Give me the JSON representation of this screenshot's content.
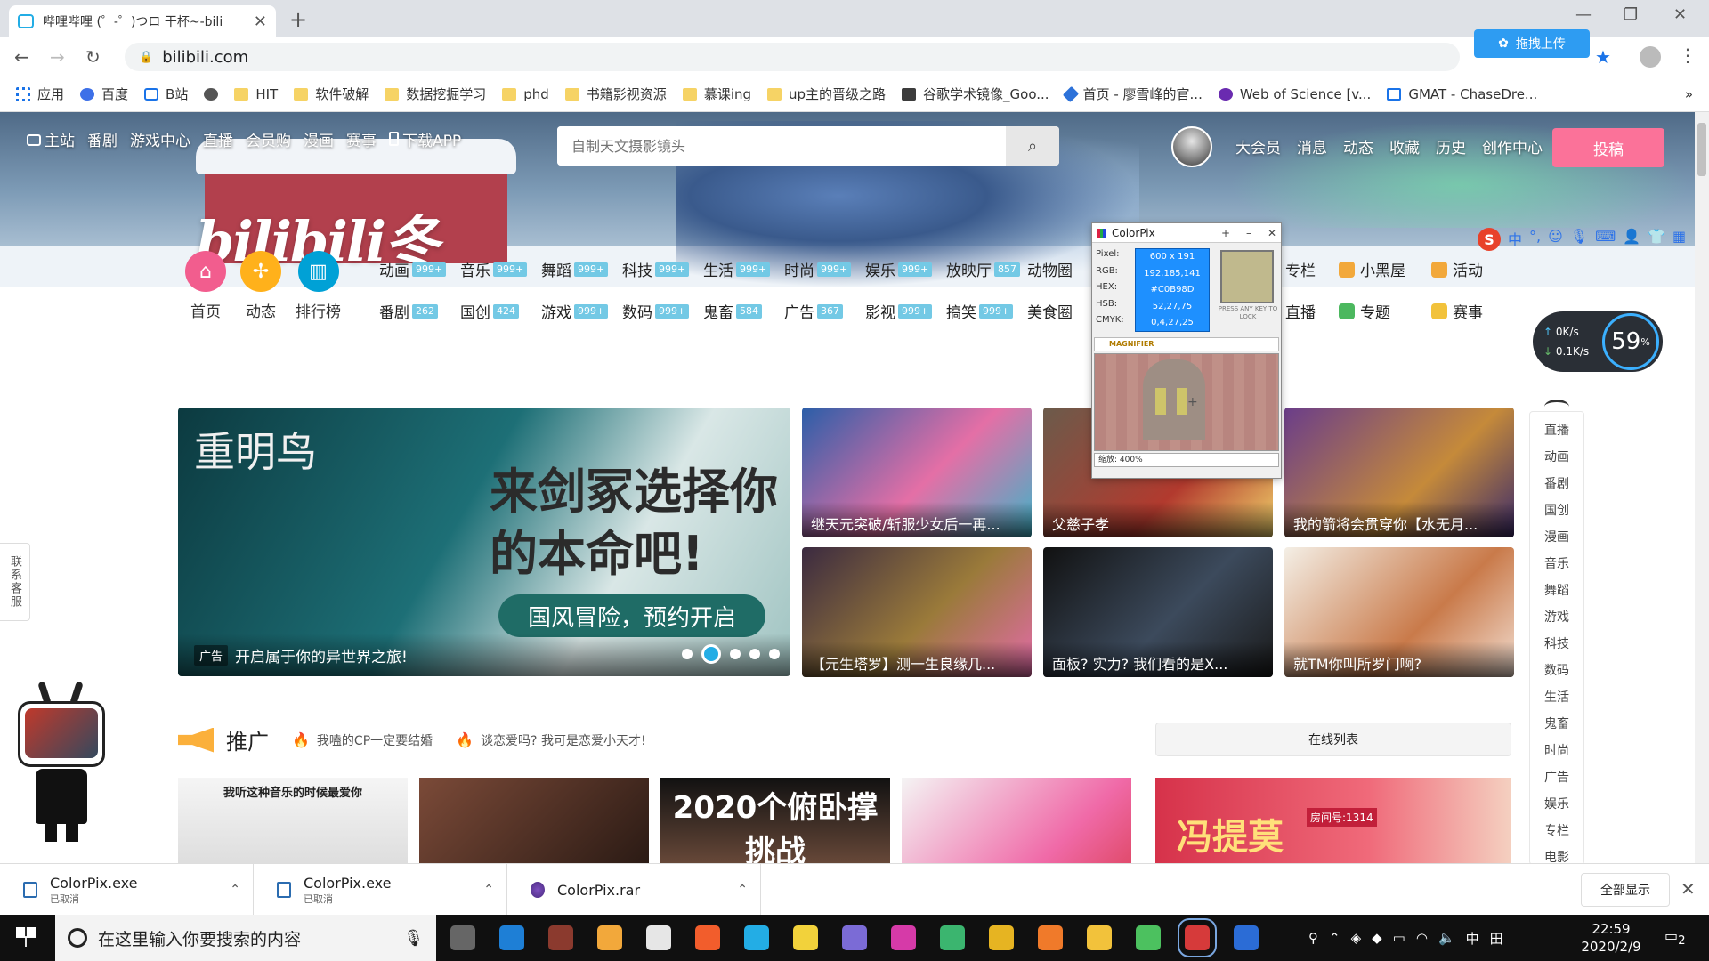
{
  "browser": {
    "tab_title": "哔哩哔哩 (゜-゜)つロ 干杯~-bili",
    "url": "bilibili.com",
    "upload_extension": "拖拽上传",
    "bookmarks": [
      {
        "label": "应用",
        "icon": "apps-grid-icon"
      },
      {
        "label": "百度",
        "icon": "baidu-paw-icon"
      },
      {
        "label": "B站",
        "icon": "bilibili-tv-icon"
      },
      {
        "label": "",
        "icon": "globe-icon"
      },
      {
        "label": "HIT",
        "icon": "folder-icon"
      },
      {
        "label": "软件破解",
        "icon": "folder-icon"
      },
      {
        "label": "数据挖掘学习",
        "icon": "folder-icon"
      },
      {
        "label": "phd",
        "icon": "folder-icon"
      },
      {
        "label": "书籍影视资源",
        "icon": "folder-icon"
      },
      {
        "label": "慕课ing",
        "icon": "folder-icon"
      },
      {
        "label": "up主的晋级之路",
        "icon": "folder-icon"
      },
      {
        "label": "谷歌学术镜像_Goo...",
        "icon": "scholar-icon"
      },
      {
        "label": "首页 - 廖雪峰的官...",
        "icon": "rocket-icon"
      },
      {
        "label": "Web of Science [v...",
        "icon": "wos-icon"
      },
      {
        "label": "GMAT - ChaseDre...",
        "icon": "gmat-icon"
      }
    ]
  },
  "header": {
    "nav": [
      "主站",
      "番剧",
      "游戏中心",
      "直播",
      "会员购",
      "漫画",
      "赛事",
      "下载APP"
    ],
    "search_placeholder": "自制天文摄影镜头",
    "user_nav": [
      "大会员",
      "消息",
      "动态",
      "收藏",
      "历史",
      "创作中心"
    ],
    "post_button": "投稿",
    "banner_logo": "bilibili冬",
    "ime_label": "中"
  },
  "quick": [
    {
      "label": "首页",
      "color": "#f25d8e",
      "icon": "home-icon"
    },
    {
      "label": "动态",
      "color": "#ffb11b",
      "icon": "pinwheel-icon"
    },
    {
      "label": "排行榜",
      "color": "#00a1d6",
      "icon": "bar-chart-icon"
    }
  ],
  "channels": [
    {
      "name": "动画",
      "count": "999+"
    },
    {
      "name": "音乐",
      "count": "999+"
    },
    {
      "name": "舞蹈",
      "count": "999+"
    },
    {
      "name": "科技",
      "count": "999+"
    },
    {
      "name": "生活",
      "count": "999+"
    },
    {
      "name": "时尚",
      "count": "999+"
    },
    {
      "name": "娱乐",
      "count": "999+"
    },
    {
      "name": "放映厅",
      "count": "857"
    },
    {
      "name": "动物圈",
      "count": ""
    },
    {
      "name": "番剧",
      "count": "262"
    },
    {
      "name": "国创",
      "count": "424"
    },
    {
      "name": "游戏",
      "count": "999+"
    },
    {
      "name": "数码",
      "count": "999+"
    },
    {
      "name": "鬼畜",
      "count": "584"
    },
    {
      "name": "广告",
      "count": "367"
    },
    {
      "name": "影视",
      "count": "999+"
    },
    {
      "name": "搞笑",
      "count": "999+"
    },
    {
      "name": "美食圈",
      "count": ""
    }
  ],
  "right_channels": [
    {
      "name": "专栏",
      "color": "#23ade5"
    },
    {
      "name": "小黑屋",
      "color": "#f2a83b"
    },
    {
      "name": "活动",
      "color": "#f2a83b"
    },
    {
      "name": "直播",
      "color": "#23ade5"
    },
    {
      "name": "专题",
      "color": "#4cb85f"
    },
    {
      "name": "赛事",
      "color": "#f2c23b"
    }
  ],
  "speed_widget": {
    "up": "0K/s",
    "down": "0.1K/s",
    "percent": "59",
    "percent_unit": "%"
  },
  "carousel": {
    "brand": "重明鸟",
    "slogan": "来剑冢选择你的本命吧!",
    "pill": "国风冒险，预约开启",
    "ad_tag": "广告",
    "caption": "开启属于你的异世界之旅!",
    "dot_count": 5,
    "active_dot": 2
  },
  "tiles": [
    {
      "caption": "继天元突破/斩服少女后一再...",
      "bg": "linear-gradient(135deg,#2b5ea8,#e46fa6 55%,#3fb3c9)"
    },
    {
      "caption": "父慈子孝",
      "bg": "linear-gradient(135deg,#6b5b4b,#b23a2e 60%,#f0d26a)"
    },
    {
      "caption": "我的箭将会贯穿你【水无月...",
      "bg": "linear-gradient(135deg,#6a3d8a,#c58a3a 60%,#3c2b6a)"
    },
    {
      "caption": "【元生塔罗】测一生良缘几...",
      "bg": "linear-gradient(135deg,#3b2a40,#9a7a3a 55%,#e36ba8)"
    },
    {
      "caption": "面板? 实力? 我们看的是X...",
      "bg": "linear-gradient(135deg,#111,#3c4a5c 55%,#1a1a1a)"
    },
    {
      "caption": "就TM你叫所罗门啊?",
      "bg": "linear-gradient(135deg,#f4efe6,#c97a4a 60%,#f2ddd0)"
    }
  ],
  "promo": {
    "title": "推广",
    "hot": [
      "我嗑的CP一定要结婚",
      "谈恋爱吗? 我可是恋爱小天才!"
    ],
    "online_list": "在线列表",
    "tiles": [
      {
        "text": "我听这种音乐的时候最爱你",
        "bg": "linear-gradient(180deg,#f5f5f5,#ddd)",
        "color": "#222"
      },
      {
        "text": "",
        "bg": "linear-gradient(135deg,#7b4a38,#2a1a14)",
        "color": "#fff"
      },
      {
        "text": "2020个俯卧撑挑战",
        "bg": "linear-gradient(180deg,#111,#6a4a3a)",
        "color": "#fff"
      },
      {
        "text": "",
        "bg": "linear-gradient(135deg,#f4f4f4,#f06aa8 70%,#e04a6a)",
        "color": "#222"
      }
    ],
    "wide_banner": {
      "text": "冯提莫",
      "room": "房间号:1314"
    }
  },
  "sidenav": [
    "直播",
    "动画",
    "番剧",
    "国创",
    "漫画",
    "音乐",
    "舞蹈",
    "游戏",
    "科技",
    "数码",
    "生活",
    "鬼畜",
    "时尚",
    "广告",
    "娱乐",
    "专栏",
    "电影"
  ],
  "customer_service": "联系客服",
  "colorpix": {
    "title": "ColorPix",
    "labels": [
      "Pixel:",
      "RGB:",
      "HEX:",
      "HSB:",
      "CMYK:"
    ],
    "values": [
      "600 x 191",
      "192,185,141",
      "#C0B98D",
      "52,27,75",
      "0,4,27,25"
    ],
    "swatch_color": "#c0b98d",
    "press_hint": "PRESS ANY KEY TO LOCK",
    "magnifier": "MAGNIFIER",
    "zoom": "缩放: 400%"
  },
  "downloads": [
    {
      "name": "ColorPix.exe",
      "status": "已取消",
      "icon": "exe-file-icon"
    },
    {
      "name": "ColorPix.exe",
      "status": "已取消",
      "icon": "exe-file-icon"
    },
    {
      "name": "ColorPix.rar",
      "status": "",
      "icon": "rar-file-icon"
    }
  ],
  "downloads_show_all": "全部显示",
  "taskbar": {
    "search_placeholder": "在这里输入你要搜索的内容",
    "apps": [
      {
        "name": "task-view-icon",
        "color": "#666"
      },
      {
        "name": "edge-icon",
        "color": "#1e7fd6"
      },
      {
        "name": "game-icon",
        "color": "#8b3a2e"
      },
      {
        "name": "g-icon",
        "color": "#f2a83b"
      },
      {
        "name": "mail-icon",
        "color": "#e6e6e6"
      },
      {
        "name": "mi-icon",
        "color": "#f25d2c"
      },
      {
        "name": "bilibili-client-icon",
        "color": "#23ade5"
      },
      {
        "name": "pikachu-icon",
        "color": "#f2d23b"
      },
      {
        "name": "orbit-icon",
        "color": "#7b6bd6"
      },
      {
        "name": "arrow-app-icon",
        "color": "#d63aa8"
      },
      {
        "name": "play-store-icon",
        "color": "#3bb56f"
      },
      {
        "name": "chrome-icon",
        "color": "#e6b422"
      },
      {
        "name": "tof-icon",
        "color": "#f07a2a"
      },
      {
        "name": "explorer-icon",
        "color": "#f2c23b"
      },
      {
        "name": "wechat-icon",
        "color": "#4cc15f"
      },
      {
        "name": "colorpix-app-icon",
        "color": "#d63a3a"
      },
      {
        "name": "word-icon",
        "color": "#2b6cd6"
      }
    ],
    "ime": "中",
    "time": "22:59",
    "date": "2020/2/9",
    "notifications": "2"
  }
}
